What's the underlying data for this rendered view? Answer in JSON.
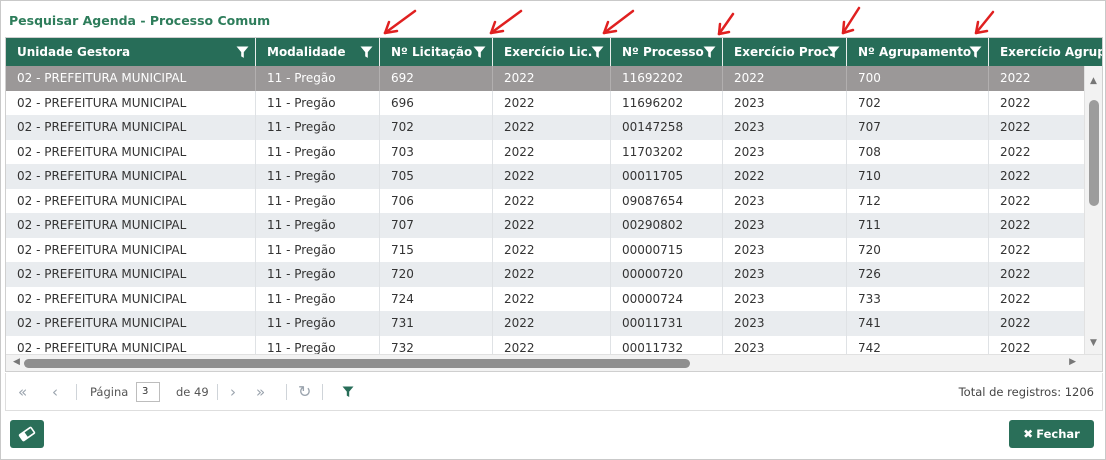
{
  "dialog": {
    "title": "Pesquisar Agenda - Processo Comum"
  },
  "table": {
    "columns": [
      {
        "label": "Unidade Gestora"
      },
      {
        "label": "Modalidade"
      },
      {
        "label": "Nº Licitação"
      },
      {
        "label": "Exercício Lic."
      },
      {
        "label": "Nº Processo"
      },
      {
        "label": "Exercício Proc."
      },
      {
        "label": "Nº Agrupamento"
      },
      {
        "label": "Exercício Agrup."
      }
    ],
    "selected_row": 0,
    "rows": [
      [
        "02 - PREFEITURA MUNICIPAL",
        "11 - Pregão",
        "692",
        "2022",
        "11692202",
        "2022",
        "700",
        "2022"
      ],
      [
        "02 - PREFEITURA MUNICIPAL",
        "11 - Pregão",
        "696",
        "2022",
        "11696202",
        "2023",
        "702",
        "2022"
      ],
      [
        "02 - PREFEITURA MUNICIPAL",
        "11 - Pregão",
        "702",
        "2022",
        "00147258",
        "2023",
        "707",
        "2022"
      ],
      [
        "02 - PREFEITURA MUNICIPAL",
        "11 - Pregão",
        "703",
        "2022",
        "11703202",
        "2023",
        "708",
        "2022"
      ],
      [
        "02 - PREFEITURA MUNICIPAL",
        "11 - Pregão",
        "705",
        "2022",
        "00011705",
        "2022",
        "710",
        "2022"
      ],
      [
        "02 - PREFEITURA MUNICIPAL",
        "11 - Pregão",
        "706",
        "2022",
        "09087654",
        "2023",
        "712",
        "2022"
      ],
      [
        "02 - PREFEITURA MUNICIPAL",
        "11 - Pregão",
        "707",
        "2022",
        "00290802",
        "2023",
        "711",
        "2022"
      ],
      [
        "02 - PREFEITURA MUNICIPAL",
        "11 - Pregão",
        "715",
        "2022",
        "00000715",
        "2023",
        "720",
        "2022"
      ],
      [
        "02 - PREFEITURA MUNICIPAL",
        "11 - Pregão",
        "720",
        "2022",
        "00000720",
        "2023",
        "726",
        "2022"
      ],
      [
        "02 - PREFEITURA MUNICIPAL",
        "11 - Pregão",
        "724",
        "2022",
        "00000724",
        "2023",
        "733",
        "2022"
      ],
      [
        "02 - PREFEITURA MUNICIPAL",
        "11 - Pregão",
        "731",
        "2022",
        "00011731",
        "2023",
        "741",
        "2022"
      ],
      [
        "02 - PREFEITURA MUNICIPAL",
        "11 - Pregão",
        "732",
        "2022",
        "00011732",
        "2023",
        "742",
        "2022"
      ]
    ]
  },
  "pager": {
    "page_label": "Página",
    "page_value": "3",
    "of_label": "de 49",
    "total_label": "Total de registros: 1206",
    "icons": [
      "first-page-icon",
      "prev-page-icon",
      "next-page-icon",
      "last-page-icon",
      "refresh-icon",
      "filter-icon"
    ]
  },
  "footer": {
    "clear_icon": "eraser-icon",
    "close_icon": "close-x-icon",
    "close_label": "Fechar"
  },
  "colors": {
    "header_bg": "#276d58",
    "title_text": "#2e7d5b",
    "selected_row": "#9b9898",
    "stripe_row": "#e9ecef",
    "annotation_arrow": "#e02020"
  }
}
